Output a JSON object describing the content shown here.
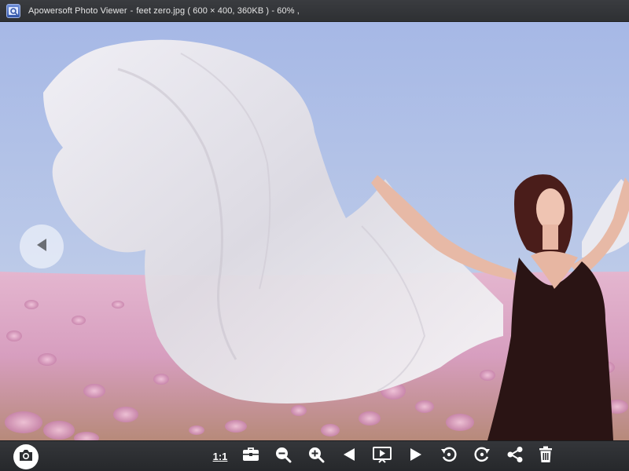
{
  "window": {
    "app_name": "Apowersoft Photo Viewer",
    "separator": "-",
    "file_info": "feet zero.jpg ( 600 × 400,   360KB )",
    "zoom_info": "- 60% ,"
  },
  "toolbar": {
    "actual_size_label": "1:1",
    "icons": [
      "camera-icon",
      "actual-size-icon",
      "toolbox-icon",
      "zoom-out-icon",
      "zoom-in-icon",
      "previous-icon",
      "slideshow-icon",
      "next-icon",
      "rotate-left-icon",
      "rotate-right-icon",
      "share-icon",
      "delete-icon"
    ]
  },
  "viewer": {
    "prev_control": "chevron-left-icon"
  },
  "colors": {
    "titlebar": "#2e3033",
    "toolbar": "#2b2d30",
    "sky": "#b3c3e6",
    "flowers": "#d9a3c2"
  }
}
